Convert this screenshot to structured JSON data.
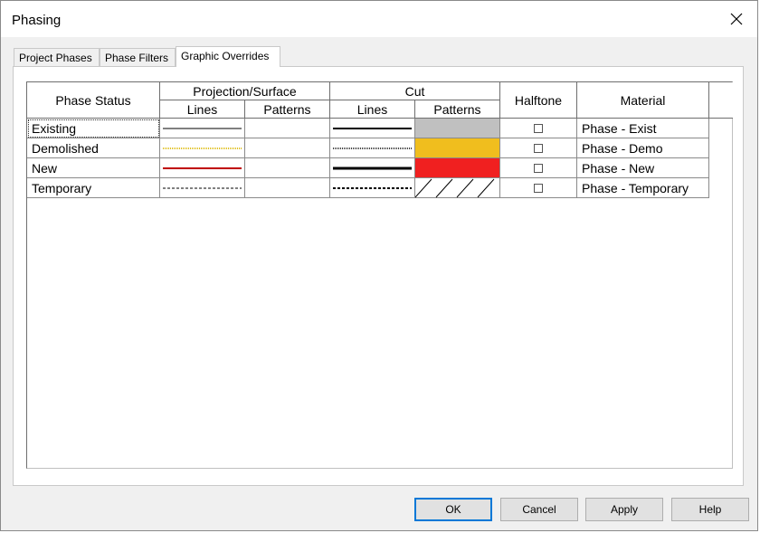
{
  "window": {
    "title": "Phasing"
  },
  "tabs": [
    {
      "label": "Project Phases",
      "active": false
    },
    {
      "label": "Phase Filters",
      "active": false
    },
    {
      "label": "Graphic Overrides",
      "active": true
    }
  ],
  "table": {
    "headers": {
      "phase_status": "Phase Status",
      "projection_surface": "Projection/Surface",
      "cut": "Cut",
      "lines": "Lines",
      "patterns": "Patterns",
      "halftone": "Halftone",
      "material": "Material"
    },
    "rows": [
      {
        "status": "Existing",
        "halftone": false,
        "material": "Phase - Exist",
        "proj_line": {
          "color": "#000000",
          "style": "solid",
          "weight": 1
        },
        "cut_line": {
          "color": "#000000",
          "style": "solid",
          "weight": 2
        },
        "cut_pattern": {
          "type": "solid-fill",
          "color": "#c0c0c0"
        }
      },
      {
        "status": "Demolished",
        "halftone": false,
        "material": "Phase - Demo",
        "proj_line": {
          "color": "#e0c020",
          "style": "dotted",
          "weight": 1
        },
        "cut_line": {
          "color": "#000000",
          "style": "dotted",
          "weight": 1
        },
        "cut_pattern": {
          "type": "solid-fill",
          "color": "#f0be1e"
        }
      },
      {
        "status": "New",
        "halftone": false,
        "material": "Phase - New",
        "proj_line": {
          "color": "#c00000",
          "style": "solid",
          "weight": 1
        },
        "cut_line": {
          "color": "#000000",
          "style": "solid",
          "weight": 3
        },
        "cut_pattern": {
          "type": "solid-fill",
          "color": "#f02020"
        }
      },
      {
        "status": "Temporary",
        "halftone": false,
        "material": "Phase - Temporary",
        "proj_line": {
          "color": "#000000",
          "style": "dashed",
          "weight": 1
        },
        "cut_line": {
          "color": "#000000",
          "style": "dashed",
          "weight": 2
        },
        "cut_pattern": {
          "type": "diagonal-hatch",
          "color": "#000000"
        }
      }
    ]
  },
  "buttons": {
    "ok": "OK",
    "cancel": "Cancel",
    "apply": "Apply",
    "help": "Help"
  }
}
